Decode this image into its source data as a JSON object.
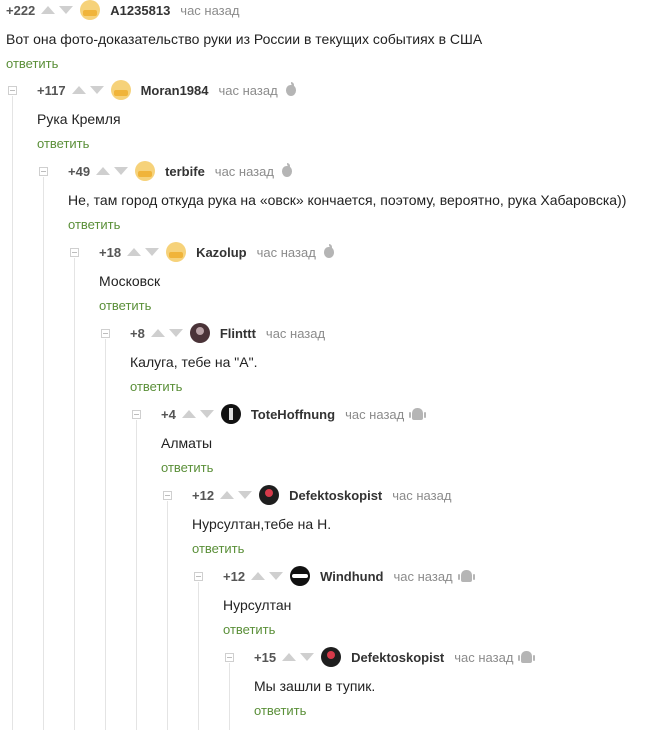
{
  "reply_label": "ответить",
  "colors": {
    "reply": "#5a8f38",
    "rating": "#555555",
    "time": "#8b8b8b",
    "line": "#e4e4e4"
  },
  "comments": [
    {
      "rating": "+222",
      "user": "A1235813",
      "time": "час назад",
      "platform": "",
      "avatar": "yellow-avatar",
      "text": "Вот она фото-доказательство руки из России в текущих событиях в США"
    },
    {
      "rating": "+117",
      "user": "Moran1984",
      "time": "час назад",
      "platform": "apple-icon",
      "avatar": "yellow-avatar",
      "text": "Рука Кремля"
    },
    {
      "rating": "+49",
      "user": "terbife",
      "time": "час назад",
      "platform": "apple-icon",
      "avatar": "yellow-avatar",
      "text": "Не, там город откуда рука на «овск» кончается, поэтому, вероятно, рука Хабаровска))"
    },
    {
      "rating": "+18",
      "user": "Kazolup",
      "time": "час назад",
      "platform": "apple-icon",
      "avatar": "yellow-avatar",
      "text": "Московск"
    },
    {
      "rating": "+8",
      "user": "Flinttt",
      "time": "час назад",
      "platform": "",
      "avatar": "dark-avatar",
      "text": "Калуга, тебе на \"А\"."
    },
    {
      "rating": "+4",
      "user": "ToteHoffnung",
      "time": "час назад",
      "platform": "android-icon",
      "avatar": "black-avatar",
      "text": "Алматы"
    },
    {
      "rating": "+12",
      "user": "Defektoskopist",
      "time": "час назад",
      "platform": "",
      "avatar": "rose-avatar",
      "text": "Нурсултан,тебе на Н."
    },
    {
      "rating": "+12",
      "user": "Windhund",
      "time": "час назад",
      "platform": "android-icon",
      "avatar": "wave-avatar",
      "text": "Нурсултан"
    },
    {
      "rating": "+15",
      "user": "Defektoskopist",
      "time": "час назад",
      "platform": "android-icon",
      "avatar": "rose-avatar",
      "text": "Мы зашли в тупик."
    }
  ]
}
